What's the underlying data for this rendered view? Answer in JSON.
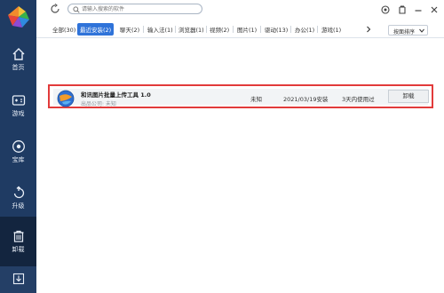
{
  "sidebar": {
    "items": [
      {
        "label": "首页",
        "icon": "home-icon"
      },
      {
        "label": "游戏",
        "icon": "gamepad-icon"
      },
      {
        "label": "宝库",
        "icon": "treasure-icon"
      },
      {
        "label": "升级",
        "icon": "upgrade-icon"
      },
      {
        "label": "卸载",
        "icon": "trash-icon",
        "active": true
      }
    ],
    "bottom_icon": "download-icon"
  },
  "search": {
    "placeholder": "请输入搜索的软件"
  },
  "tabs": [
    {
      "label": "全部(30)"
    },
    {
      "label": "最近安装(2)",
      "active": true
    },
    {
      "label": "聊天(2)"
    },
    {
      "label": "输入法(1)"
    },
    {
      "label": "浏览器(1)"
    },
    {
      "label": "视频(2)"
    },
    {
      "label": "图片(1)"
    },
    {
      "label": "驱动(13)"
    },
    {
      "label": "办公(1)"
    },
    {
      "label": "游戏(1)"
    }
  ],
  "sort": {
    "label": "按面排序"
  },
  "apps": [
    {
      "name": "和讯图片批量上传工具 1.0",
      "publisher": "出品公司: 未知",
      "size": "未知",
      "install_date": "2021/03/19安装",
      "usage": "3天内使用过",
      "button": "卸载"
    }
  ],
  "colors": {
    "sidebar": "#1f3b63",
    "accent": "#2f73d9",
    "highlight": "#e23b3b"
  }
}
